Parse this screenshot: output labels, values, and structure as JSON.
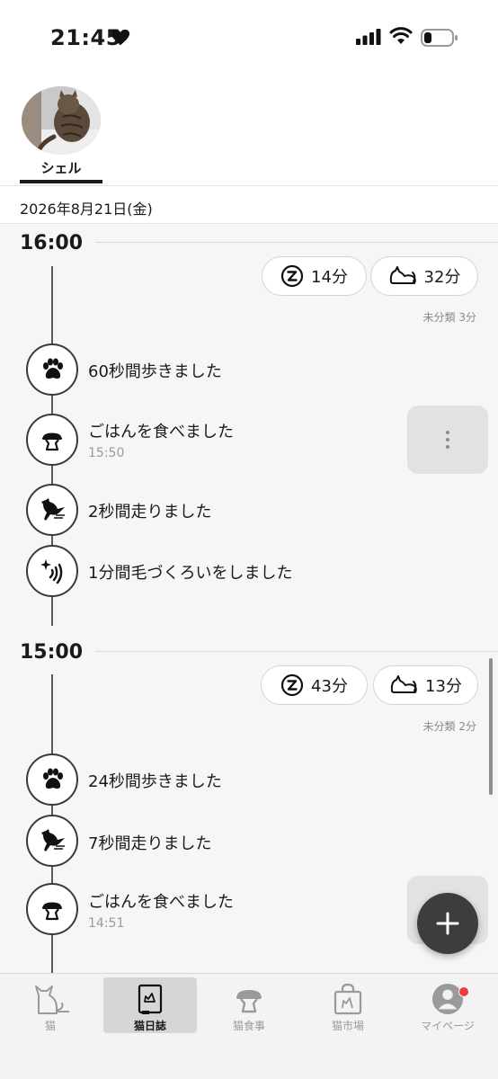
{
  "status_bar": {
    "time": "21:45"
  },
  "header": {
    "cat_tabs": [
      {
        "name": "シェル",
        "selected": true
      }
    ],
    "date": "2026年8月21日(金)"
  },
  "timeline": [
    {
      "hour": "16:00",
      "sleep": {
        "icon": "sleep-z-icon",
        "value": "14分"
      },
      "rest": {
        "icon": "lying-cat-icon",
        "value": "32分"
      },
      "uncategorized": "未分類 3分",
      "events": [
        {
          "icon": "paw-icon",
          "text": "60秒間歩きました",
          "time": ""
        },
        {
          "icon": "food-bowl-icon",
          "text": "ごはんを食べました",
          "time": "15:50"
        },
        {
          "icon": "running-cat-icon",
          "text": "2秒間走りました",
          "time": ""
        },
        {
          "icon": "grooming-icon",
          "text": "1分間毛づくろいをしました",
          "time": ""
        }
      ]
    },
    {
      "hour": "15:00",
      "sleep": {
        "icon": "sleep-z-icon",
        "value": "43分"
      },
      "rest": {
        "icon": "lying-cat-icon",
        "value": "13分"
      },
      "uncategorized": "未分類 2分",
      "events": [
        {
          "icon": "paw-icon",
          "text": "24秒間歩きました",
          "time": ""
        },
        {
          "icon": "running-cat-icon",
          "text": "7秒間走りました",
          "time": ""
        },
        {
          "icon": "food-bowl-icon",
          "text": "ごはんを食べました",
          "time": "14:51"
        }
      ]
    }
  ],
  "bottom_nav": [
    {
      "label": "猫",
      "icon": "cat-icon",
      "active": false
    },
    {
      "label": "猫日誌",
      "icon": "diary-icon",
      "active": true
    },
    {
      "label": "猫食事",
      "icon": "food-bowl-icon",
      "active": false
    },
    {
      "label": "猫市場",
      "icon": "shopping-bag-icon",
      "active": false
    },
    {
      "label": "マイページ",
      "icon": "profile-icon",
      "active": false,
      "has_notification": true
    }
  ],
  "colors": {
    "accent": "#1a1a1a",
    "badge": "#ef3b3b",
    "fab": "#3d3d3d"
  }
}
